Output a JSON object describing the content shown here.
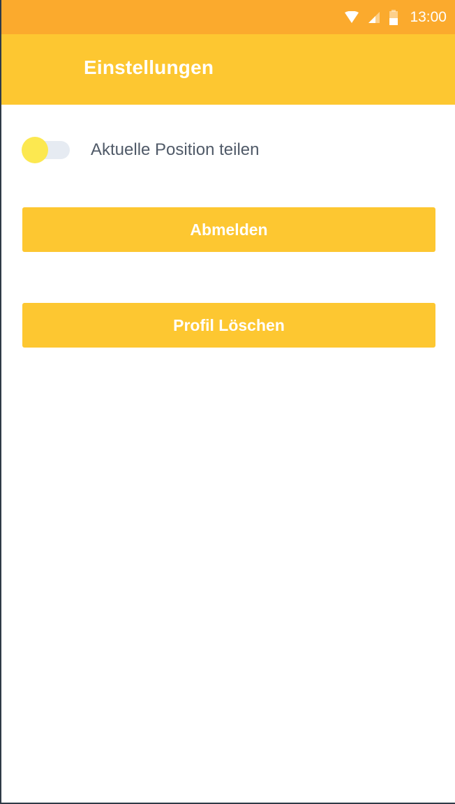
{
  "status_bar": {
    "time": "13:00",
    "icons": [
      "wifi-icon",
      "signal-icon",
      "battery-icon"
    ],
    "color": "#fbaa2d"
  },
  "app_bar": {
    "title": "Einstellungen",
    "color": "#fdc731"
  },
  "settings": {
    "share_location": {
      "label": "Aktuelle Position teilen",
      "enabled": false
    },
    "logout_label": "Abmelden",
    "delete_profile_label": "Profil Löschen"
  },
  "colors": {
    "accent": "#fdc731",
    "toggle_thumb": "#fce850",
    "toggle_track": "#e6ebf2",
    "label_text": "#505a68"
  }
}
